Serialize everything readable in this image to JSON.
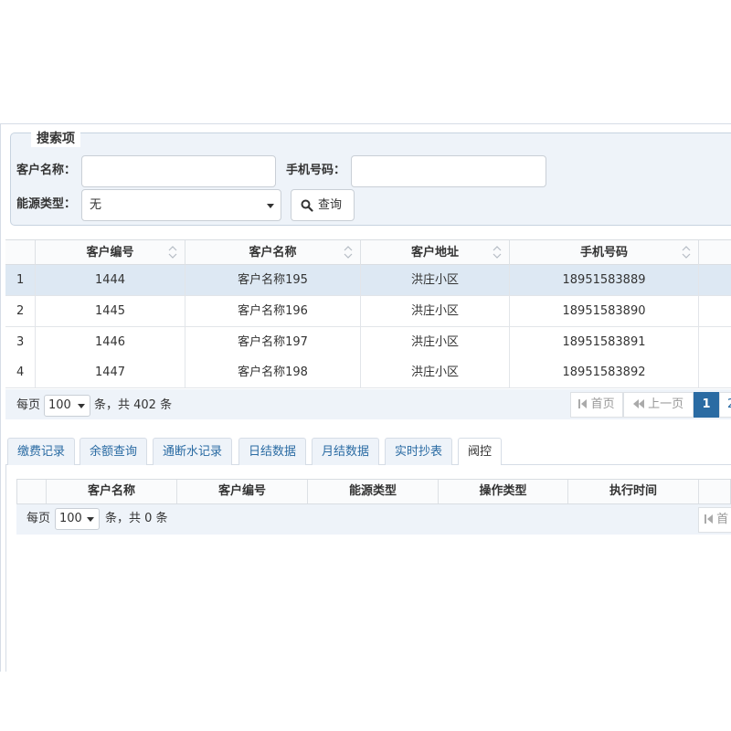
{
  "search": {
    "legend": "搜索项",
    "customer_name_label": "客户名称：",
    "customer_name_value": "",
    "phone_label": "手机号码：",
    "phone_value": "",
    "energy_type_label": "能源类型：",
    "energy_type_value": "无",
    "query_button": "查询"
  },
  "grid": {
    "columns": [
      "",
      "客户编号",
      "客户名称",
      "客户地址",
      "手机号码"
    ],
    "rows": [
      {
        "idx": "1",
        "code": "1444",
        "name": "客户名称195",
        "address": "洪庄小区",
        "phone": "18951583889"
      },
      {
        "idx": "2",
        "code": "1445",
        "name": "客户名称196",
        "address": "洪庄小区",
        "phone": "18951583890"
      },
      {
        "idx": "3",
        "code": "1446",
        "name": "客户名称197",
        "address": "洪庄小区",
        "phone": "18951583891"
      },
      {
        "idx": "4",
        "code": "1447",
        "name": "客户名称198",
        "address": "洪庄小区",
        "phone": "18951583892"
      }
    ],
    "selected_row": 0,
    "pager": {
      "per_page_label": "每页",
      "page_size": "100",
      "total_text": "条，共 402 条",
      "first": "首页",
      "prev": "上一页",
      "current_page": "1",
      "next_page_partial": "2"
    }
  },
  "tabs": [
    "缴费记录",
    "余额查询",
    "通断水记录",
    "日结数据",
    "月结数据",
    "实时抄表",
    "阀控"
  ],
  "active_tab": 6,
  "sub_grid": {
    "columns": [
      "",
      "客户名称",
      "客户编号",
      "能源类型",
      "操作类型",
      "执行时间"
    ],
    "pager": {
      "per_page_label": "每页",
      "page_size": "100",
      "total_text": "条，共 0 条",
      "first_partial": "首"
    }
  },
  "colors": {
    "accent": "#2a6ba3",
    "panel_bg": "#eef3f9",
    "selected_row": "#dde8f3"
  }
}
